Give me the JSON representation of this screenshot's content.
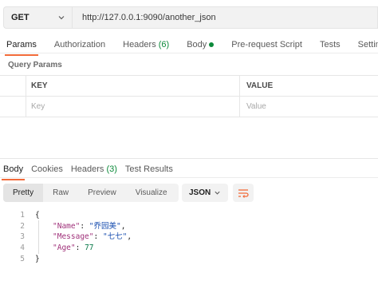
{
  "request": {
    "method": "GET",
    "url": "http://127.0.0.1:9090/another_json"
  },
  "request_tabs": [
    {
      "label": "Params",
      "active": true
    },
    {
      "label": "Authorization"
    },
    {
      "label": "Headers",
      "count": "(6)"
    },
    {
      "label": "Body",
      "dot": true
    },
    {
      "label": "Pre-request Script"
    },
    {
      "label": "Tests"
    },
    {
      "label": "Settings"
    }
  ],
  "query_params": {
    "title": "Query Params",
    "key_header": "KEY",
    "value_header": "VALUE",
    "key_placeholder": "Key",
    "value_placeholder": "Value"
  },
  "response_tabs": [
    {
      "label": "Body",
      "active": true
    },
    {
      "label": "Cookies"
    },
    {
      "label": "Headers",
      "count": "(3)"
    },
    {
      "label": "Test Results"
    }
  ],
  "format_tabs": [
    "Pretty",
    "Raw",
    "Preview",
    "Visualize"
  ],
  "language": "JSON",
  "response_body": {
    "line_numbers": [
      "1",
      "2",
      "3",
      "4",
      "5"
    ],
    "open": "{",
    "close": "}",
    "fields": [
      {
        "key": "\"Name\"",
        "value": "\"乔园美\"",
        "type": "string",
        "comma": ","
      },
      {
        "key": "\"Message\"",
        "value": "\"七七\"",
        "type": "string",
        "comma": ","
      },
      {
        "key": "\"Age\"",
        "value": "77",
        "type": "number",
        "comma": ""
      }
    ]
  },
  "colors": {
    "accent": "#f26b3a",
    "success": "#0c8a3a",
    "json_key": "#a0327a",
    "json_string": "#1a4fb0",
    "json_number": "#0a7a4a"
  },
  "icons": [
    "chevron-down-icon",
    "wrap-lines-icon"
  ]
}
